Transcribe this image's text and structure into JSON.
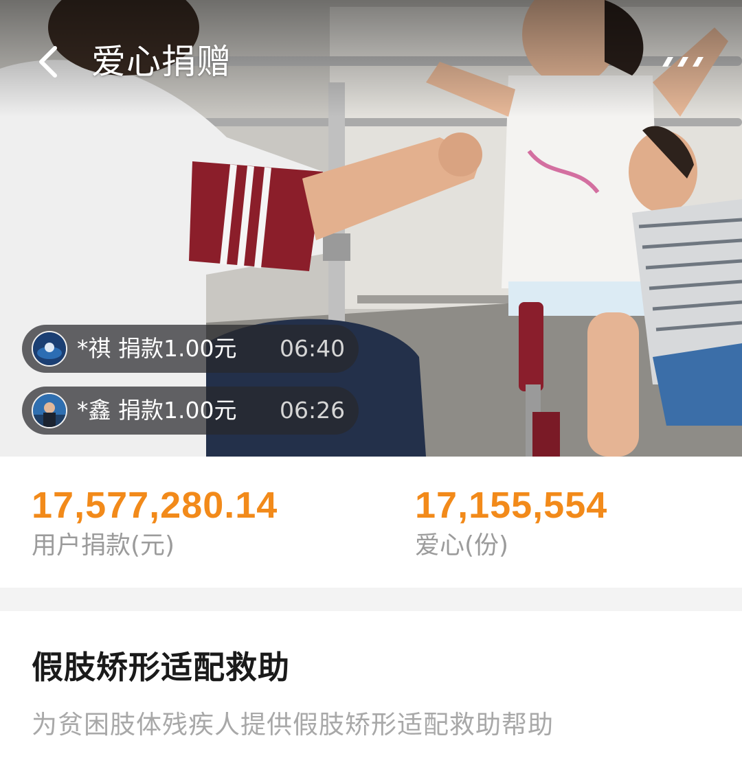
{
  "nav": {
    "title": "爱心捐赠",
    "back_icon": "chevron-left-icon",
    "more_icon": "more-dots-icon"
  },
  "hero": {
    "description_icon": "project-photo"
  },
  "donations": [
    {
      "name_amount": "*祺 捐款1.00元",
      "time": "06:40"
    },
    {
      "name_amount": "*鑫 捐款1.00元",
      "time": "06:26"
    }
  ],
  "stats": {
    "amount": {
      "value": "17,577,280.14",
      "label": "用户捐款(元)"
    },
    "hearts": {
      "value": "17,155,554",
      "label": "爱心(份)"
    }
  },
  "project": {
    "title": "假肢矫形适配救助",
    "description": "为贫困肢体残疾人提供假肢矫形适配救助帮助"
  },
  "colors": {
    "accent": "#f28a1a",
    "label_gray": "#9b9b9b",
    "title_dark": "#1a1a1a",
    "desc_gray": "#a8a8a8"
  }
}
